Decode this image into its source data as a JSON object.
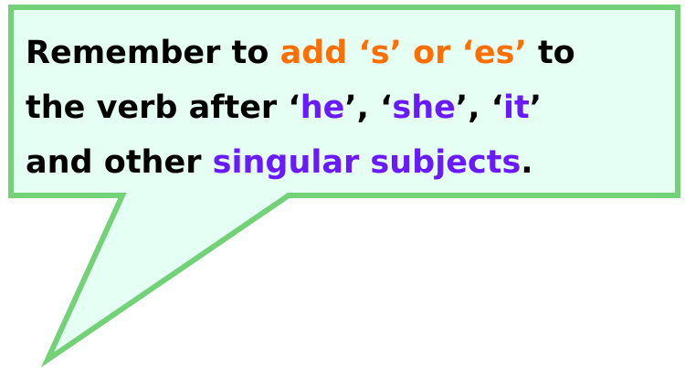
{
  "colors": {
    "bubble_fill": "#e6fff4",
    "bubble_border": "#73d178",
    "text": "#000000",
    "orange": "#ff6f00",
    "purple": "#6a1aff"
  },
  "lines": [
    {
      "segments": [
        {
          "text": "Remember to ",
          "style": "plain"
        },
        {
          "text": "add ‘s’ or ‘es’",
          "style": "orange"
        },
        {
          "text": " to",
          "style": "plain"
        }
      ]
    },
    {
      "segments": [
        {
          "text": "the verb after ‘",
          "style": "plain"
        },
        {
          "text": "he",
          "style": "purple"
        },
        {
          "text": "’, ‘",
          "style": "plain"
        },
        {
          "text": "she",
          "style": "purple"
        },
        {
          "text": "’, ‘",
          "style": "plain"
        },
        {
          "text": "it",
          "style": "purple"
        },
        {
          "text": "’",
          "style": "plain"
        }
      ]
    },
    {
      "segments": [
        {
          "text": "and other ",
          "style": "plain"
        },
        {
          "text": "singular subjects",
          "style": "purple"
        },
        {
          "text": ".",
          "style": "plain"
        }
      ]
    }
  ]
}
